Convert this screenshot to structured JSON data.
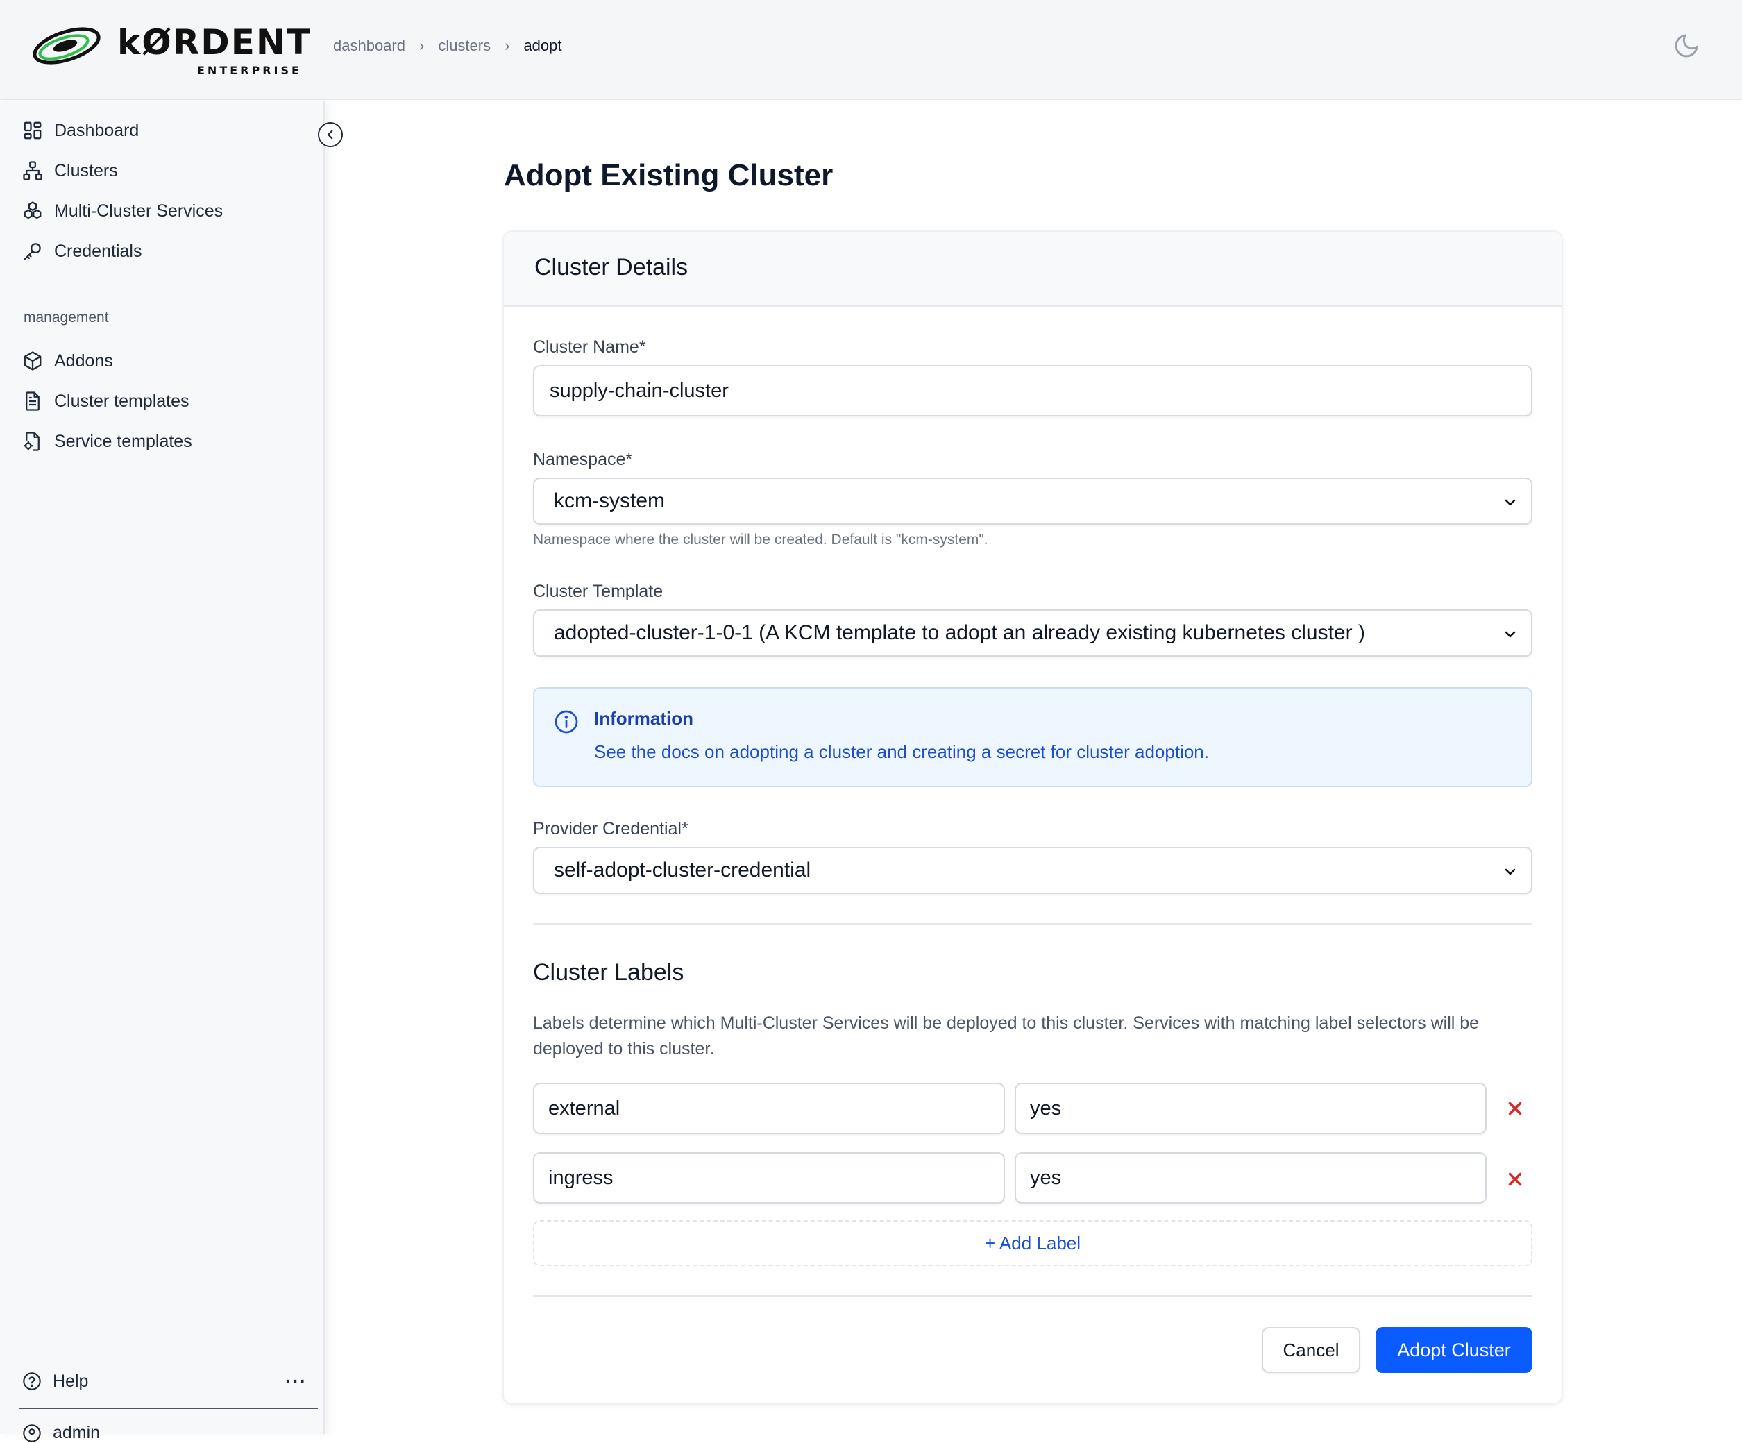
{
  "brand": {
    "name": "kØRDENT",
    "subtitle": "ENTERPRISE"
  },
  "breadcrumb": [
    "dashboard",
    "clusters",
    "adopt"
  ],
  "sidebar": {
    "items": [
      {
        "label": "Dashboard",
        "icon": "dashboard-icon"
      },
      {
        "label": "Clusters",
        "icon": "clusters-icon"
      },
      {
        "label": "Multi-Cluster Services",
        "icon": "services-icon"
      },
      {
        "label": "Credentials",
        "icon": "key-icon"
      }
    ],
    "section": "management",
    "management_items": [
      {
        "label": "Addons",
        "icon": "box-icon"
      },
      {
        "label": "Cluster templates",
        "icon": "file-icon"
      },
      {
        "label": "Service templates",
        "icon": "file-gear-icon"
      }
    ],
    "help": "Help",
    "user": "admin"
  },
  "page": {
    "title": "Adopt Existing Cluster"
  },
  "form": {
    "header": "Cluster Details",
    "cluster_name": {
      "label": "Cluster Name*",
      "value": "supply-chain-cluster"
    },
    "namespace": {
      "label": "Namespace*",
      "value": "kcm-system",
      "hint": "Namespace where the cluster will be created. Default is \"kcm-system\"."
    },
    "template": {
      "label": "Cluster Template",
      "value": "adopted-cluster-1-0-1 (A KCM template to adopt an already existing kubernetes cluster )"
    },
    "info": {
      "title": "Information",
      "text": "See the docs on adopting a cluster and creating a secret for cluster adoption."
    },
    "credential": {
      "label": "Provider Credential*",
      "value": "self-adopt-cluster-credential"
    },
    "labels_section": {
      "title": "Cluster Labels",
      "description": "Labels determine which Multi-Cluster Services will be deployed to this cluster. Services with matching label selectors will be deployed to this cluster.",
      "labels": [
        {
          "key": "external",
          "value": "yes"
        },
        {
          "key": "ingress",
          "value": "yes"
        }
      ],
      "add_label": "+ Add Label"
    },
    "cancel": "Cancel",
    "submit": "Adopt Cluster"
  }
}
